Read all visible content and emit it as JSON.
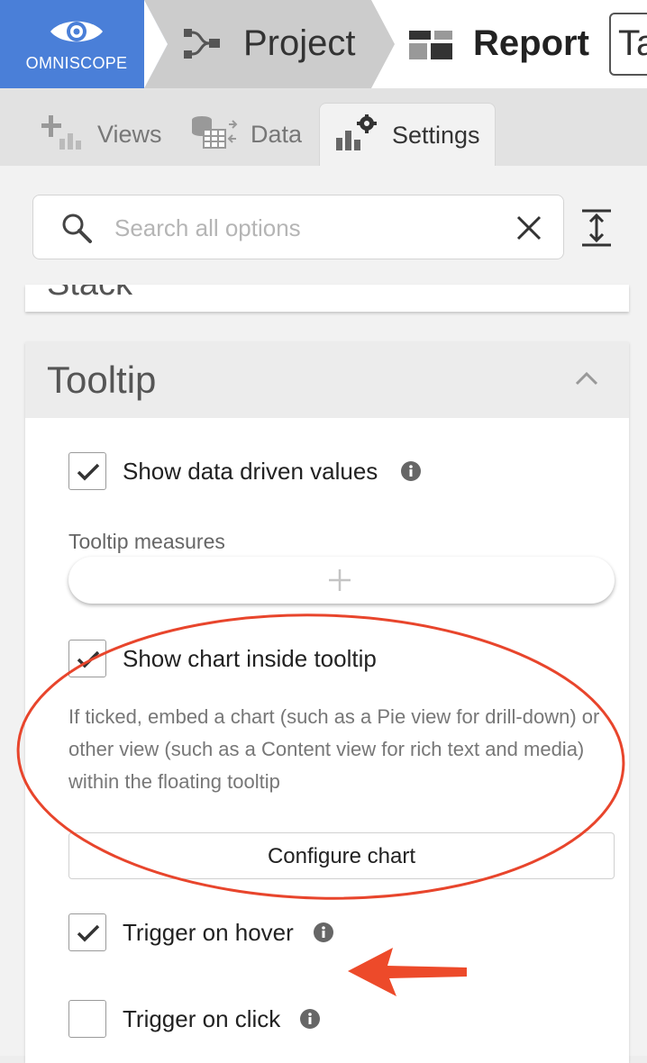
{
  "breadcrumb": {
    "logo_text": "OMNISCOPE",
    "project_label": "Project",
    "report_label": "Report",
    "truncated_label": "Ta"
  },
  "tabs": [
    {
      "label": "Views",
      "icon": "chart-add-icon",
      "active": false
    },
    {
      "label": "Data",
      "icon": "data-transform-icon",
      "active": false
    },
    {
      "label": "Settings",
      "icon": "chart-settings-icon",
      "active": true
    }
  ],
  "search": {
    "placeholder": "Search all options",
    "value": ""
  },
  "sections": {
    "stack": {
      "title": "Stack"
    },
    "tooltip": {
      "title": "Tooltip",
      "expanded": true,
      "options": {
        "show_data_driven_values": {
          "label": "Show data driven values",
          "checked": true
        },
        "tooltip_measures_label": "Tooltip measures",
        "show_chart_inside_tooltip": {
          "label": "Show chart inside tooltip",
          "checked": true
        },
        "chart_description": "If ticked, embed a chart (such as a Pie view for drill-down) or other view (such as a Content view for rich text and media) within the floating tooltip",
        "configure_chart_label": "Configure chart",
        "trigger_on_hover": {
          "label": "Trigger on hover",
          "checked": true
        },
        "trigger_on_click": {
          "label": "Trigger on click",
          "checked": false
        }
      }
    }
  },
  "colors": {
    "logo_blue": "#4a7fd8",
    "breadcrumb_grey": "#cccccc",
    "annotation_red": "#e8452c",
    "checkmark": "#333333"
  }
}
